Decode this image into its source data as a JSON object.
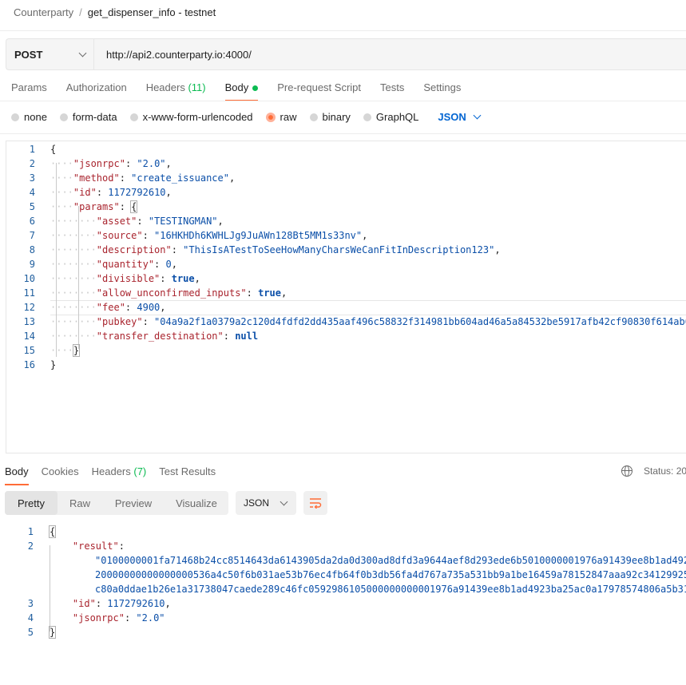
{
  "breadcrumb": {
    "parent": "Counterparty",
    "separator": "/",
    "current": "get_dispenser_info - testnet"
  },
  "request": {
    "method": "POST",
    "url": "http://api2.counterparty.io:4000/"
  },
  "req_tabs": [
    {
      "label": "Params"
    },
    {
      "label": "Authorization"
    },
    {
      "label": "Headers",
      "count": "(11)"
    },
    {
      "label": "Body",
      "active": true
    },
    {
      "label": "Pre-request Script"
    },
    {
      "label": "Tests"
    },
    {
      "label": "Settings"
    }
  ],
  "body_types": [
    "none",
    "form-data",
    "x-www-form-urlencoded",
    "raw",
    "binary",
    "GraphQL"
  ],
  "selected_body_type": "raw",
  "body_format": "JSON",
  "request_body": {
    "line_numbers": [
      "1",
      "2",
      "3",
      "4",
      "5",
      "6",
      "7",
      "8",
      "9",
      "10",
      "11",
      "12",
      "13",
      "14",
      "15",
      "16"
    ],
    "jsonrpc": "\"2.0\"",
    "method": "\"create_issuance\"",
    "id": "1172792610",
    "asset": "\"TESTINGMAN\"",
    "source": "\"16HKHDh6KWHLJg9JuAWn128Bt5MM1s33nv\"",
    "description": "\"ThisIsATestToSeeHowManyCharsWeCanFitInDescription123\"",
    "quantity": "0",
    "divisible": "true",
    "allow_unconfirmed_inputs": "true",
    "fee": "4900",
    "pubkey": "\"04a9a2f1a0379a2c120d4fdfd2dd435aaf496c58832f314981bb604ad46a5a84532be5917afb42cf90830f614ab6",
    "transfer_destination": "null"
  },
  "resp_tabs": [
    {
      "label": "Body",
      "active": true
    },
    {
      "label": "Cookies"
    },
    {
      "label": "Headers",
      "count": "(7)"
    },
    {
      "label": "Test Results"
    }
  ],
  "status_text": "Status: 20",
  "view_buttons": [
    "Pretty",
    "Raw",
    "Preview",
    "Visualize"
  ],
  "response_format": "JSON",
  "response_body": {
    "line_numbers": [
      "1",
      "2",
      "3",
      "4",
      "5"
    ],
    "result_line1": "\"0100000001fa71468b24cc8514643da6143905da2da0d300ad8dfd3a9644aef8d293ede6b5010000001976a91439ee8b1ad492",
    "result_line2": "20000000000000000536a4c50f6b031ae53b76ec4fb64f0b3db56fa4d767a735a531bb9a1be16459a78152847aaa92c34129925",
    "result_line3": "c80a0ddae1b26e1a31738047caede289c46fc0592986105000000000001976a91439ee8b1ad4923ba25ac0a17978574806a5b319",
    "id": "1172792610",
    "jsonrpc": "\"2.0\""
  },
  "colors": {
    "accent": "#ff6c37",
    "active_dot": "#0cbb52",
    "link_blue": "#0265d2",
    "json_key": "#a9242e",
    "json_value": "#0b4fa8"
  }
}
